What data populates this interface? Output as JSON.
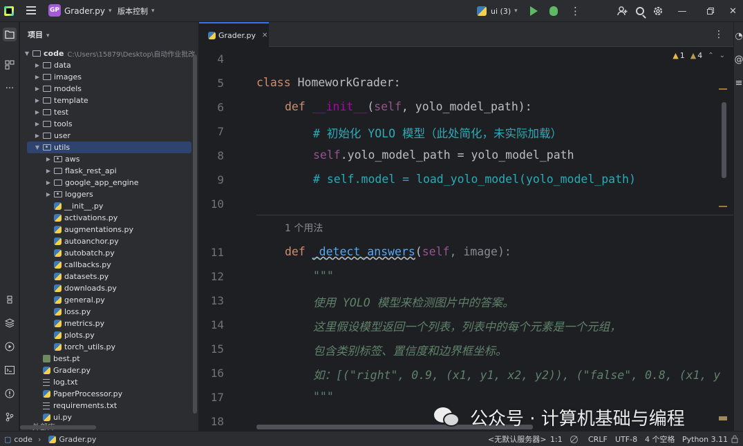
{
  "titlebar": {
    "project_badge": "GP",
    "project_name": "Grader.py",
    "vcs_label": "版本控制",
    "run_config": "ui (3)",
    "more_icon": "⋮"
  },
  "project_panel": {
    "header": "项目",
    "root": {
      "name": "code",
      "path": "C:\\Users\\15879\\Desktop\\自动作业批改"
    },
    "items": [
      {
        "name": "data",
        "type": "folder",
        "depth": 1
      },
      {
        "name": "images",
        "type": "folder",
        "depth": 1
      },
      {
        "name": "models",
        "type": "folder",
        "depth": 1
      },
      {
        "name": "template",
        "type": "folder",
        "depth": 1
      },
      {
        "name": "test",
        "type": "folder",
        "depth": 1
      },
      {
        "name": "tools",
        "type": "folder",
        "depth": 1
      },
      {
        "name": "user",
        "type": "folder",
        "depth": 1
      },
      {
        "name": "utils",
        "type": "package",
        "depth": 1,
        "expanded": true,
        "selected": true
      },
      {
        "name": "aws",
        "type": "package",
        "depth": 2
      },
      {
        "name": "flask_rest_api",
        "type": "folder",
        "depth": 2
      },
      {
        "name": "google_app_engine",
        "type": "folder",
        "depth": 2
      },
      {
        "name": "loggers",
        "type": "package",
        "depth": 2
      },
      {
        "name": "__init__.py",
        "type": "py",
        "depth": 2
      },
      {
        "name": "activations.py",
        "type": "py",
        "depth": 2
      },
      {
        "name": "augmentations.py",
        "type": "py",
        "depth": 2
      },
      {
        "name": "autoanchor.py",
        "type": "py",
        "depth": 2
      },
      {
        "name": "autobatch.py",
        "type": "py",
        "depth": 2
      },
      {
        "name": "callbacks.py",
        "type": "py",
        "depth": 2
      },
      {
        "name": "datasets.py",
        "type": "py",
        "depth": 2
      },
      {
        "name": "downloads.py",
        "type": "py",
        "depth": 2
      },
      {
        "name": "general.py",
        "type": "py",
        "depth": 2
      },
      {
        "name": "loss.py",
        "type": "py",
        "depth": 2
      },
      {
        "name": "metrics.py",
        "type": "py",
        "depth": 2
      },
      {
        "name": "plots.py",
        "type": "py",
        "depth": 2
      },
      {
        "name": "torch_utils.py",
        "type": "py",
        "depth": 2
      },
      {
        "name": "best.pt",
        "type": "pt",
        "depth": 1
      },
      {
        "name": "Grader.py",
        "type": "py",
        "depth": 1
      },
      {
        "name": "log.txt",
        "type": "txt",
        "depth": 1
      },
      {
        "name": "PaperProcessor.py",
        "type": "py",
        "depth": 1
      },
      {
        "name": "requirements.txt",
        "type": "txt",
        "depth": 1
      },
      {
        "name": "ui.py",
        "type": "py",
        "depth": 1
      }
    ],
    "clipped_item": "外部库"
  },
  "editor": {
    "tab_label": "Grader.py",
    "inspections": {
      "warnings": "1",
      "weak_warnings": "4"
    },
    "usage_hint": "1 个用法",
    "line_numbers": [
      "4",
      "5",
      "6",
      "7",
      "8",
      "9",
      "10",
      "11",
      "12",
      "13",
      "14",
      "15",
      "16",
      "17",
      "18"
    ],
    "code": {
      "l5_kw": "class",
      "l5_name": " HomeworkGrader:",
      "l6_kw": "def",
      "l6_fn": "__init__",
      "l6_open": "(",
      "l6_self": "self",
      "l6_rest": ", yolo_model_path):",
      "l7": "# 初始化 YOLO 模型（此处简化，未实际加载）",
      "l8_self": "self",
      "l8_rest": ".yolo_model_path = yolo_model_path",
      "l9": "# self.model = load_yolo_model(yolo_model_path)",
      "l11_kw": "def",
      "l11_fn": "_detect_answers",
      "l11_open": "(",
      "l11_self": "self",
      "l11_rest": ", image):",
      "l12": "\"\"\"",
      "l13": "使用 YOLO 模型来检测图片中的答案。",
      "l14": "这里假设模型返回一个列表，列表中的每个元素是一个元组，",
      "l15": "包含类别标签、置信度和边界框坐标。",
      "l16": "如：[(\"right\", 0.9, (x1, y1, x2, y2)), (\"false\", 0.8, (x1, y",
      "l17": "\"\"\""
    }
  },
  "statusbar": {
    "breadcrumb_root": "code",
    "breadcrumb_file": "Grader.py",
    "server": "<无默认服务器>",
    "position": "1:1",
    "line_sep": "CRLF",
    "encoding": "UTF-8",
    "indent": "4 个空格",
    "interpreter": "Python 3.11"
  },
  "watermark": {
    "text": "公众号 · 计算机基础与编程"
  }
}
